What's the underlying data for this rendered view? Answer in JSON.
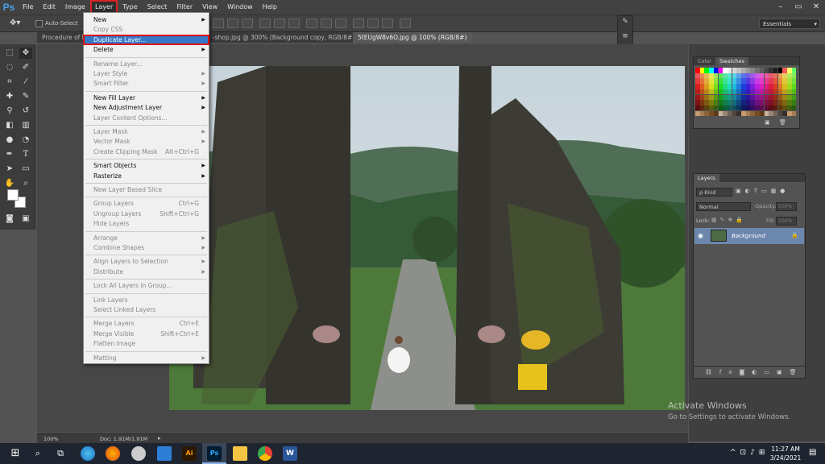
{
  "app": {
    "logo": "Ps"
  },
  "menubar": {
    "items": [
      "File",
      "Edit",
      "Image",
      "Layer",
      "Type",
      "Select",
      "Filter",
      "View",
      "Window",
      "Help"
    ],
    "active": "Layer",
    "window_controls": [
      "–",
      "▭",
      "✕"
    ]
  },
  "options": {
    "auto_select_label": "Auto-Select",
    "workspace": "Essentials"
  },
  "tabs": [
    {
      "label": "Procedure of h",
      "active": false
    },
    {
      "label": "-shop.jpg @ 300% (Background copy, RGB/8#) *",
      "active": false
    },
    {
      "label": "5tEUgW8v6O.jpg @ 100% (RGB/8#)",
      "active": true
    }
  ],
  "layer_menu": {
    "items": [
      {
        "label": "New",
        "shortcut": "",
        "submenu": true,
        "disabled": false
      },
      {
        "label": "Copy CSS",
        "shortcut": "",
        "submenu": false,
        "disabled": true
      },
      {
        "label": "Duplicate Layer...",
        "shortcut": "",
        "submenu": false,
        "disabled": false,
        "highlighted": true
      },
      {
        "label": "Delete",
        "shortcut": "",
        "submenu": true,
        "disabled": false
      },
      {
        "label": "Rename Layer...",
        "shortcut": "",
        "submenu": false,
        "disabled": true
      },
      {
        "label": "Layer Style",
        "shortcut": "",
        "submenu": true,
        "disabled": true
      },
      {
        "label": "Smart Filter",
        "shortcut": "",
        "submenu": true,
        "disabled": true
      },
      {
        "label": "New Fill Layer",
        "shortcut": "",
        "submenu": true,
        "disabled": false
      },
      {
        "label": "New Adjustment Layer",
        "shortcut": "",
        "submenu": true,
        "disabled": false
      },
      {
        "label": "Layer Content Options...",
        "shortcut": "",
        "submenu": false,
        "disabled": true
      },
      {
        "label": "Layer Mask",
        "shortcut": "",
        "submenu": true,
        "disabled": true
      },
      {
        "label": "Vector Mask",
        "shortcut": "",
        "submenu": true,
        "disabled": true
      },
      {
        "label": "Create Clipping Mask",
        "shortcut": "Alt+Ctrl+G",
        "submenu": false,
        "disabled": true
      },
      {
        "label": "Smart Objects",
        "shortcut": "",
        "submenu": true,
        "disabled": false
      },
      {
        "label": "Rasterize",
        "shortcut": "",
        "submenu": true,
        "disabled": false
      },
      {
        "label": "New Layer Based Slice",
        "shortcut": "",
        "submenu": false,
        "disabled": true
      },
      {
        "label": "Group Layers",
        "shortcut": "Ctrl+G",
        "submenu": false,
        "disabled": true
      },
      {
        "label": "Ungroup Layers",
        "shortcut": "Shift+Ctrl+G",
        "submenu": false,
        "disabled": true
      },
      {
        "label": "Hide Layers",
        "shortcut": "",
        "submenu": false,
        "disabled": true
      },
      {
        "label": "Arrange",
        "shortcut": "",
        "submenu": true,
        "disabled": true
      },
      {
        "label": "Combine Shapes",
        "shortcut": "",
        "submenu": true,
        "disabled": true
      },
      {
        "label": "Align Layers to Selection",
        "shortcut": "",
        "submenu": true,
        "disabled": true
      },
      {
        "label": "Distribute",
        "shortcut": "",
        "submenu": true,
        "disabled": true
      },
      {
        "label": "Lock All Layers in Group...",
        "shortcut": "",
        "submenu": false,
        "disabled": true
      },
      {
        "label": "Link Layers",
        "shortcut": "",
        "submenu": false,
        "disabled": true
      },
      {
        "label": "Select Linked Layers",
        "shortcut": "",
        "submenu": false,
        "disabled": true
      },
      {
        "label": "Merge Layers",
        "shortcut": "Ctrl+E",
        "submenu": false,
        "disabled": true
      },
      {
        "label": "Merge Visible",
        "shortcut": "Shift+Ctrl+E",
        "submenu": false,
        "disabled": true
      },
      {
        "label": "Flatten Image",
        "shortcut": "",
        "submenu": false,
        "disabled": true
      },
      {
        "label": "Matting",
        "shortcut": "",
        "submenu": true,
        "disabled": true
      }
    ]
  },
  "color_panel": {
    "tabs": [
      "Color",
      "Swatches"
    ],
    "active": "Swatches"
  },
  "layers_panel": {
    "title": "Layers",
    "kind_label": "ρ Kind",
    "blend_mode": "Normal",
    "opacity_label": "Opacity:",
    "opacity_value": "100%",
    "lock_label": "Lock:",
    "fill_label": "Fill:",
    "fill_value": "100%",
    "layer_name": "Background"
  },
  "status": {
    "zoom": "100%",
    "doc": "Doc: 1.91M/1.91M"
  },
  "watermark": {
    "title": "Activate Windows",
    "subtitle": "Go to Settings to activate Windows."
  },
  "taskbar": {
    "time": "11:27 AM",
    "date": "3/24/2021"
  },
  "colors": {
    "highlight": "#3478c6",
    "red_box": "#dd1111",
    "layer_selected": "#6c87ad"
  }
}
